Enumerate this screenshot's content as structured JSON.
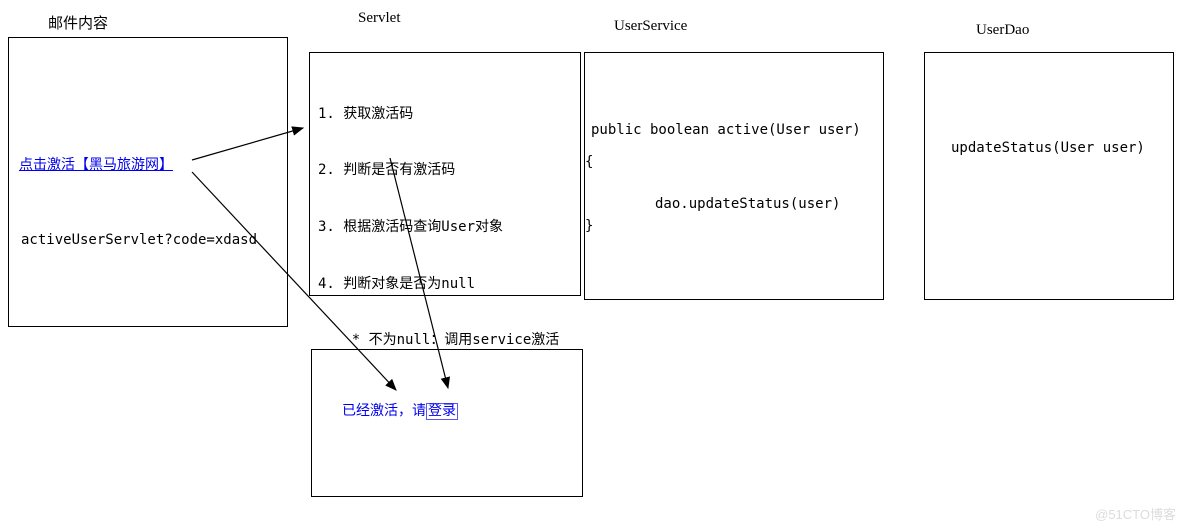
{
  "titles": {
    "email": "邮件内容",
    "servlet": "Servlet",
    "userService": "UserService",
    "userDao": "UserDao"
  },
  "emailBox": {
    "linkText": "点击激活【黑马旅游网】",
    "url": "activeUserServlet?code=xdasd"
  },
  "servletBox": {
    "line1": "1. 获取激活码",
    "line2": "2. 判断是否有激活码",
    "line3": "3. 根据激活码查询User对象",
    "line4": "4. 判断对象是否为null",
    "line5": "    * 不为null：调用service激活"
  },
  "userServiceBox": {
    "signature": "public boolean active(User user)",
    "openBrace": "{",
    "call": "dao.updateStatus(user)",
    "closeBrace": "}"
  },
  "userDaoBox": {
    "method": "updateStatus(User user)"
  },
  "resultBox": {
    "prefix": "已经激活，请",
    "loginLink": "登录"
  },
  "watermark": "@51CTO博客"
}
